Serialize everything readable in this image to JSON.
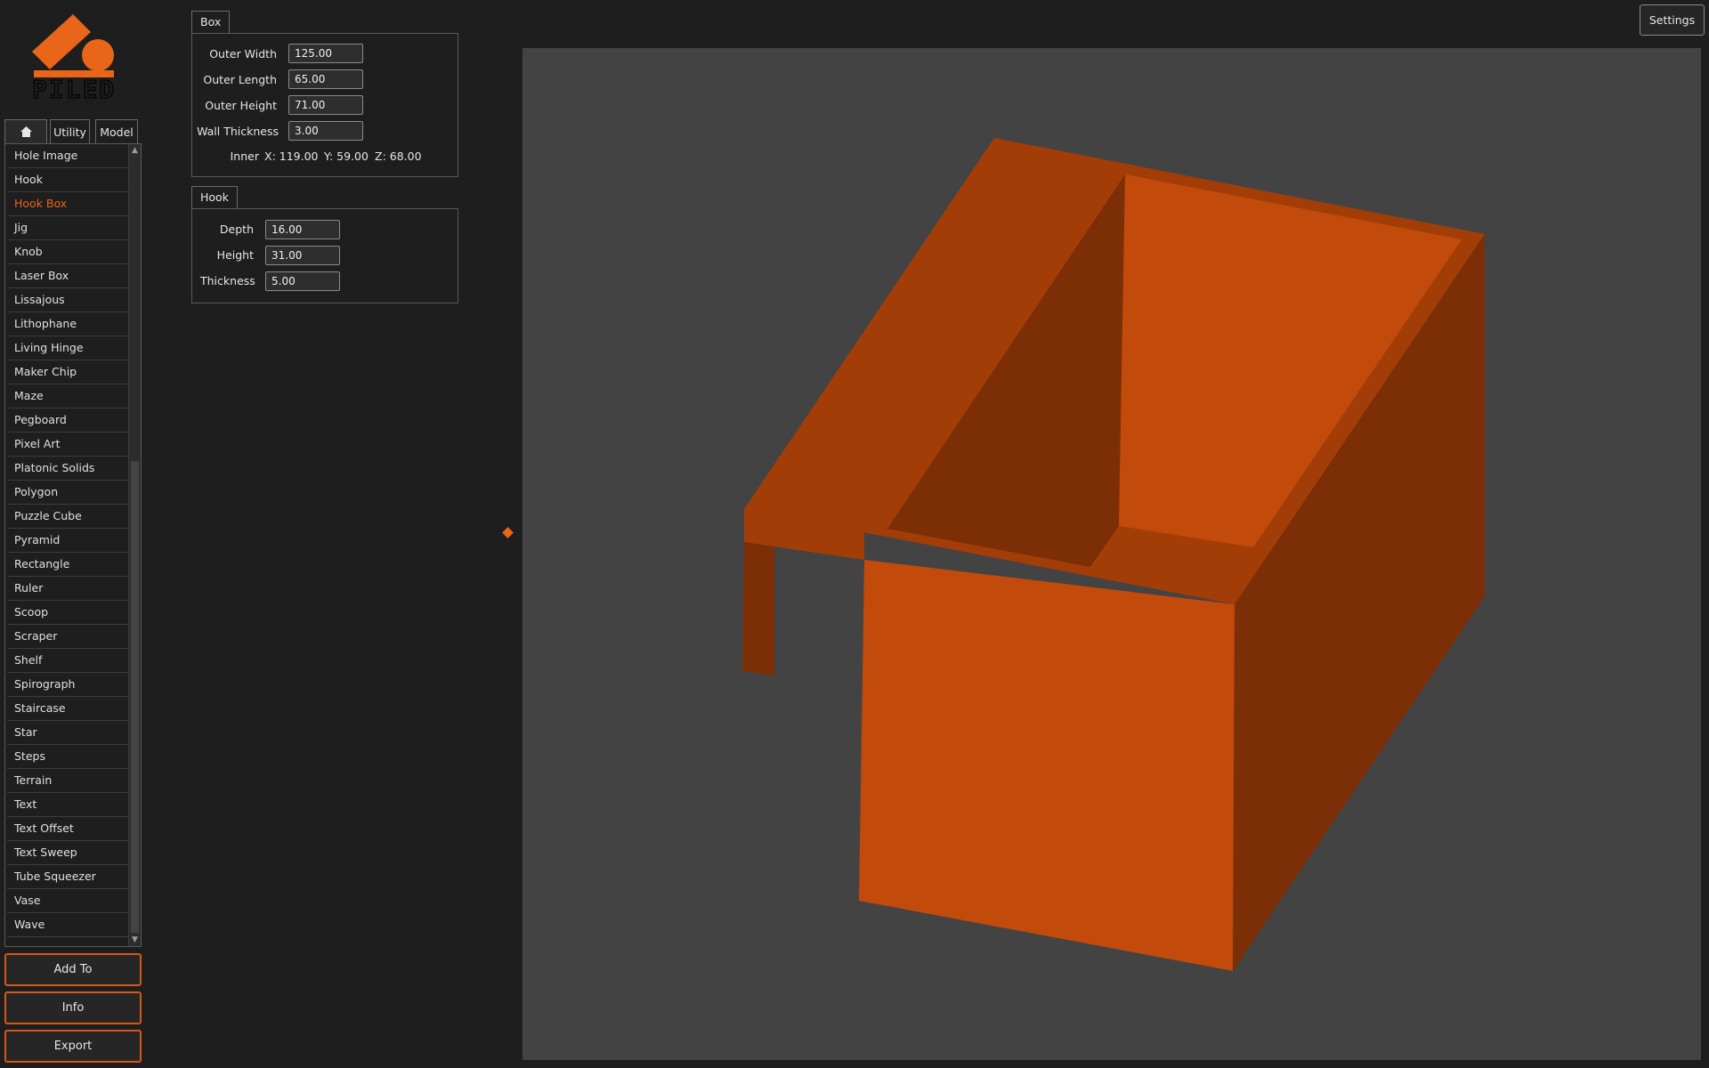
{
  "app": {
    "logo_text": "PILED",
    "accent_color": "#e8651a",
    "tabs": [
      {
        "icon": "home-icon",
        "label": ""
      },
      {
        "label": "Utility"
      },
      {
        "label": "Model"
      }
    ],
    "settings_label": "Settings"
  },
  "model_list": {
    "selected": "Hook Box",
    "items": [
      "Hole Image",
      "Hook",
      "Hook Box",
      "Jig",
      "Knob",
      "Laser Box",
      "Lissajous",
      "Lithophane",
      "Living Hinge",
      "Maker Chip",
      "Maze",
      "Pegboard",
      "Pixel Art",
      "Platonic Solids",
      "Polygon",
      "Puzzle Cube",
      "Pyramid",
      "Rectangle",
      "Ruler",
      "Scoop",
      "Scraper",
      "Shelf",
      "Spirograph",
      "Staircase",
      "Star",
      "Steps",
      "Terrain",
      "Text",
      "Text Offset",
      "Text Sweep",
      "Tube Squeezer",
      "Vase",
      "Wave"
    ]
  },
  "actions": {
    "add_to": "Add To",
    "info": "Info",
    "export": "Export"
  },
  "box_group": {
    "title": "Box",
    "outer_width_label": "Outer Width",
    "outer_width": "125.00",
    "outer_length_label": "Outer Length",
    "outer_length": "65.00",
    "outer_height_label": "Outer Height",
    "outer_height": "71.00",
    "wall_thickness_label": "Wall Thickness",
    "wall_thickness": "3.00",
    "inner_label": "Inner",
    "inner_x": "X: 119.00",
    "inner_y": "Y: 59.00",
    "inner_z": "Z: 68.00"
  },
  "hook_group": {
    "title": "Hook",
    "depth_label": "Depth",
    "depth": "16.00",
    "height_label": "Height",
    "height": "31.00",
    "thickness_label": "Thickness",
    "thickness": "5.00"
  },
  "viewport": {
    "background": "#434343",
    "model_color": "#c24a0a"
  }
}
